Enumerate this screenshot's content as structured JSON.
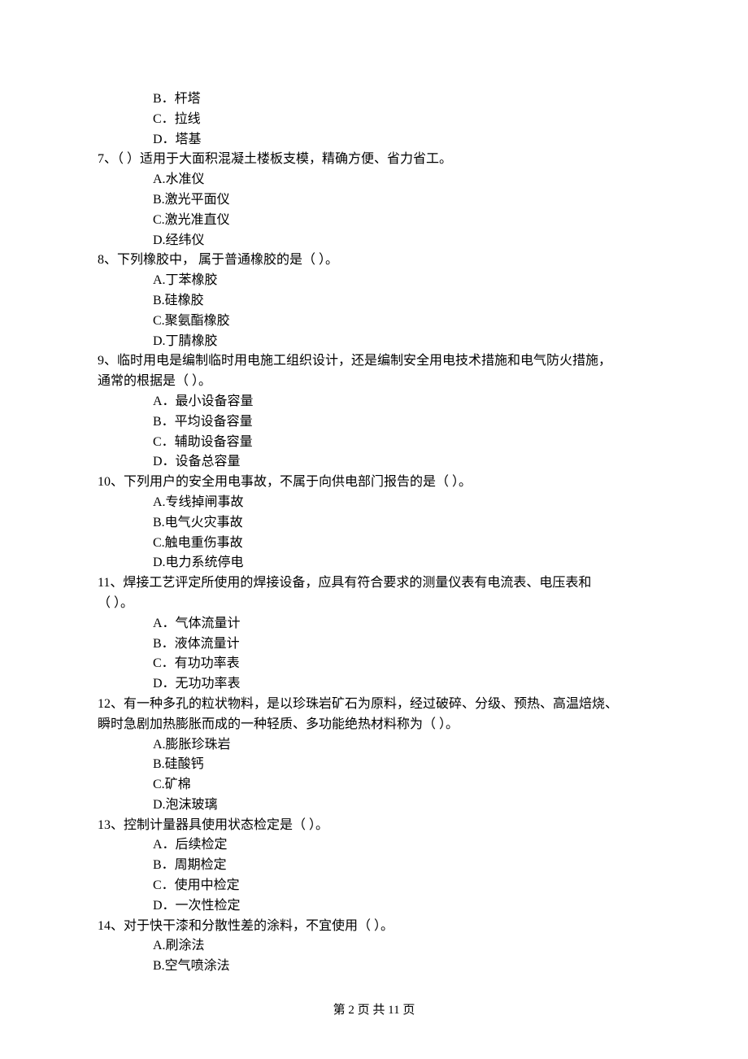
{
  "q6": {
    "optB": "B．杆塔",
    "optC": "C．拉线",
    "optD": "D．塔基"
  },
  "q7": {
    "stem": "7、（    ）适用于大面积混凝土楼板支模，精确方便、省力省工。",
    "optA": "A.水准仪",
    "optB": "B.激光平面仪",
    "optC": "C.激光准直仪",
    "optD": "D.经纬仪"
  },
  "q8": {
    "stem": "8、下列橡胶中， 属于普通橡胶的是（    ）。",
    "optA": "A.丁苯橡胶",
    "optB": "B.硅橡胶",
    "optC": "C.聚氨酯橡胶",
    "optD": "D.丁腈橡胶"
  },
  "q9": {
    "stem": "9、临时用电是编制临时用电施工组织设计，还是编制安全用电技术措施和电气防火措施，",
    "stem2": "通常的根据是（    ）。",
    "optA": "A．最小设备容量",
    "optB": "B．平均设备容量",
    "optC": "C．辅助设备容量",
    "optD": "D．设备总容量"
  },
  "q10": {
    "stem": "10、下列用户的安全用电事故，不属于向供电部门报告的是（    ）。",
    "optA": "A.专线掉闸事故",
    "optB": "B.电气火灾事故",
    "optC": "C.触电重伤事故",
    "optD": "D.电力系统停电"
  },
  "q11": {
    "stem": "11、焊接工艺评定所使用的焊接设备，应具有符合要求的测量仪表有电流表、电压表和",
    "stem2": "（    ）。",
    "optA": "A．气体流量计",
    "optB": "B．液体流量计",
    "optC": "C．有功功率表",
    "optD": "D．无功功率表"
  },
  "q12": {
    "stem": "12、有一种多孔的粒状物料，是以珍珠岩矿石为原料，经过破碎、分级、预热、高温焙烧、",
    "stem2": "瞬时急剧加热膨胀而成的一种轻质、多功能绝热材料称为（    ）。",
    "optA": "A.膨胀珍珠岩",
    "optB": "B.硅酸钙",
    "optC": "C.矿棉",
    "optD": "D.泡沫玻璃"
  },
  "q13": {
    "stem": "13、控制计量器具使用状态检定是（    ）。",
    "optA": "A．后续检定",
    "optB": "B．周期检定",
    "optC": "C．使用中检定",
    "optD": "D．一次性检定"
  },
  "q14": {
    "stem": "14、对于快干漆和分散性差的涂料，不宜使用（    ）。",
    "optA": "A.刷涂法",
    "optB": "B.空气喷涂法"
  },
  "footer": "第 2 页 共 11 页"
}
